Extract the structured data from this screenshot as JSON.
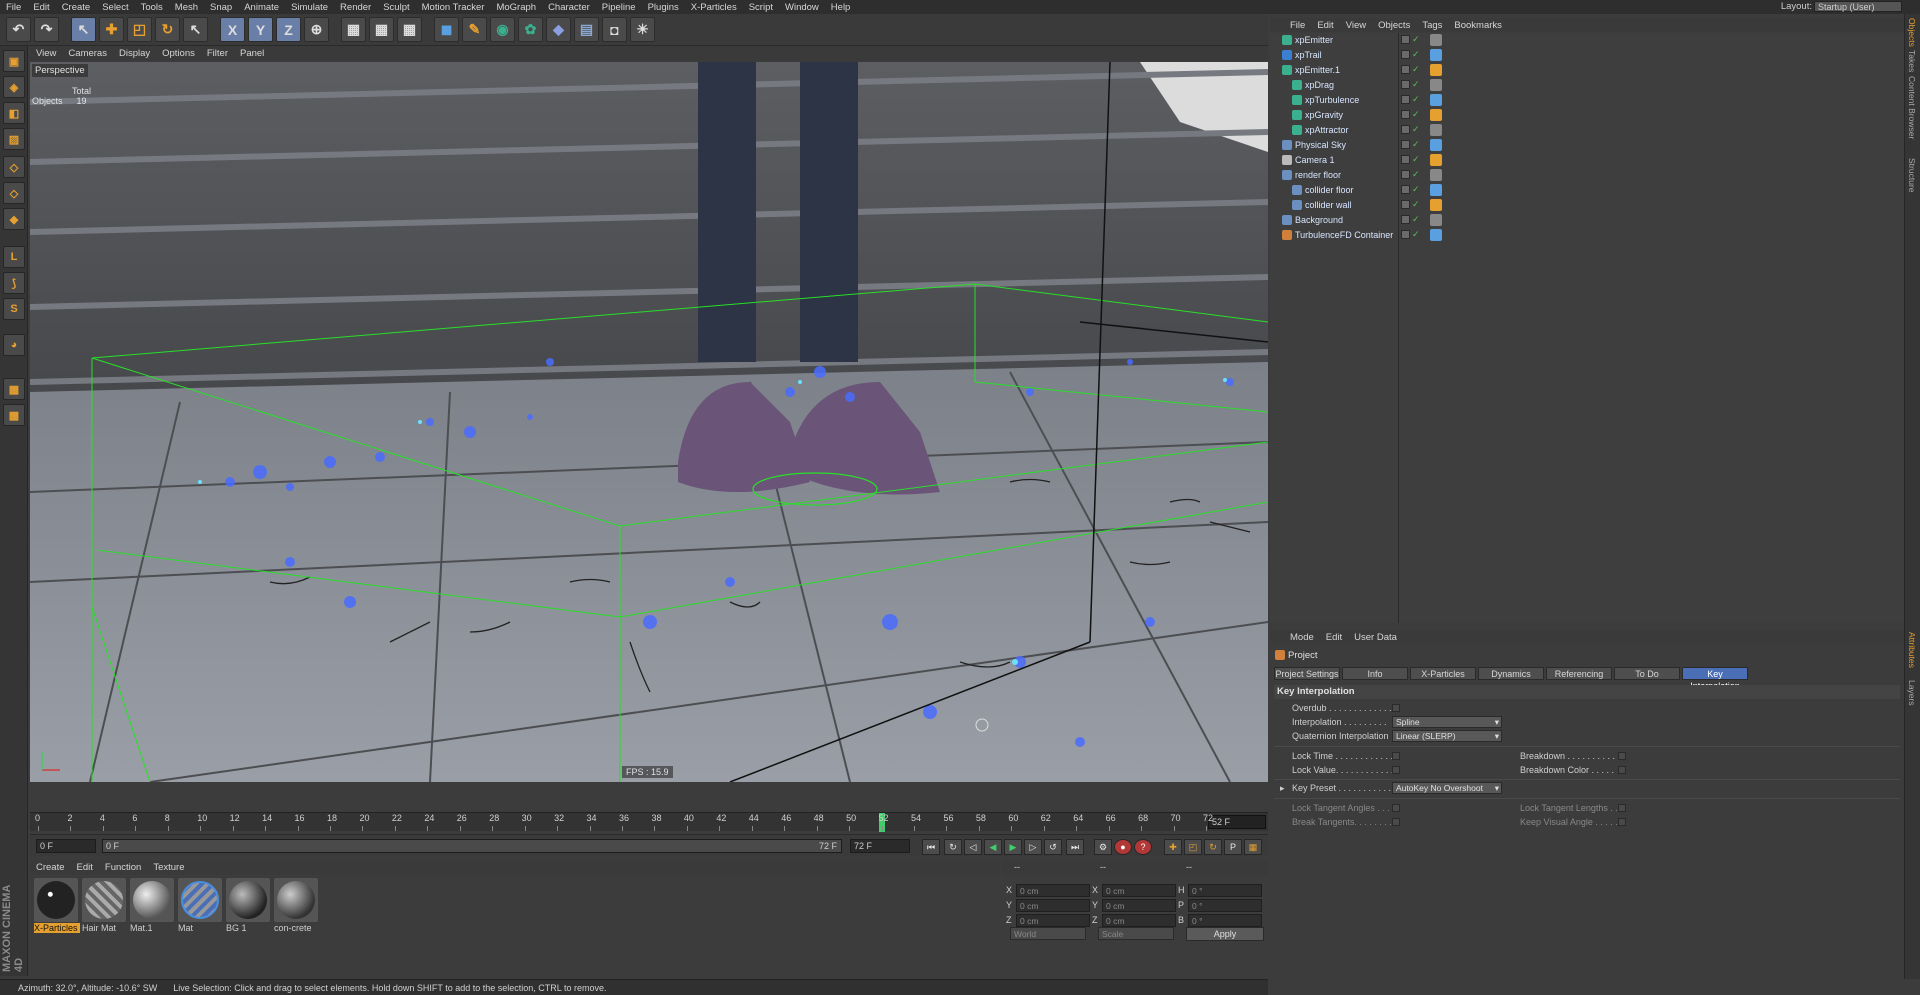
{
  "menubar": {
    "items": [
      "File",
      "Edit",
      "Create",
      "Select",
      "Tools",
      "Mesh",
      "Snap",
      "Animate",
      "Simulate",
      "Render",
      "Sculpt",
      "Motion Tracker",
      "MoGraph",
      "Character",
      "Pipeline",
      "Plugins",
      "X-Particles",
      "Script",
      "Window",
      "Help"
    ],
    "layout_label": "Layout:",
    "layout_value": "Startup (User)"
  },
  "toolbar": {
    "axis_x": "X",
    "axis_y": "Y",
    "axis_z": "Z"
  },
  "viewport": {
    "menu": [
      "View",
      "Cameras",
      "Display",
      "Options",
      "Filter",
      "Panel"
    ],
    "title": "Perspective",
    "hud_total_label": "Total",
    "hud_objects_label": "Objects",
    "hud_objects_value": "19",
    "fps": "FPS : 15.9"
  },
  "timeline": {
    "ticks": [
      "0",
      "2",
      "4",
      "6",
      "8",
      "10",
      "12",
      "14",
      "16",
      "18",
      "20",
      "22",
      "24",
      "26",
      "28",
      "30",
      "32",
      "34",
      "36",
      "38",
      "40",
      "42",
      "44",
      "46",
      "48",
      "50",
      "52",
      "54",
      "56",
      "58",
      "60",
      "62",
      "64",
      "66",
      "68",
      "70",
      "72"
    ],
    "current_frame": 52,
    "max_frame": 72,
    "end_field": "52 F"
  },
  "transport": {
    "start_field": "0 F",
    "range_start": "0 F",
    "range_end": "72 F",
    "end_field": "72 F"
  },
  "materials": {
    "menu": [
      "Create",
      "Edit",
      "Function",
      "Texture"
    ],
    "items": [
      {
        "name": "X-Particles",
        "highlighted": true
      },
      {
        "name": "Hair Mat",
        "highlighted": false
      },
      {
        "name": "Mat.1",
        "highlighted": false
      },
      {
        "name": "Mat",
        "highlighted": false
      },
      {
        "name": "BG 1",
        "highlighted": false
      },
      {
        "name": "con-crete",
        "highlighted": false
      }
    ]
  },
  "coordinates": {
    "header_left": "--",
    "header_mid": "--",
    "header_right": "--",
    "rows": [
      {
        "a": "X",
        "av": "0 cm",
        "b": "X",
        "bv": "0 cm",
        "c": "H",
        "cv": "0 °"
      },
      {
        "a": "Y",
        "av": "0 cm",
        "b": "Y",
        "bv": "0 cm",
        "c": "P",
        "cv": "0 °"
      },
      {
        "a": "Z",
        "av": "0 cm",
        "b": "Z",
        "bv": "0 cm",
        "c": "B",
        "cv": "0 °"
      }
    ],
    "mode1": "World",
    "mode2": "Scale",
    "apply": "Apply"
  },
  "statusbar": {
    "left": "Azimuth: 32.0°, Altitude: -10.6°  SW",
    "message": "Live Selection: Click and drag to select elements. Hold down SHIFT to add to the selection, CTRL to remove."
  },
  "objects": {
    "menu": [
      "File",
      "Edit",
      "View",
      "Objects",
      "Tags",
      "Bookmarks"
    ],
    "rows": [
      {
        "name": "xpEmitter",
        "indent": 0,
        "icon": "#3bb08f"
      },
      {
        "name": "xpTrail",
        "indent": 0,
        "icon": "#3b7fd0"
      },
      {
        "name": "xpEmitter.1",
        "indent": 0,
        "icon": "#3bb08f"
      },
      {
        "name": "xpDrag",
        "indent": 1,
        "icon": "#3bb08f"
      },
      {
        "name": "xpTurbulence",
        "indent": 1,
        "icon": "#3bb08f"
      },
      {
        "name": "xpGravity",
        "indent": 1,
        "icon": "#3bb08f"
      },
      {
        "name": "xpAttractor",
        "indent": 1,
        "icon": "#3bb08f"
      },
      {
        "name": "Physical Sky",
        "indent": 0,
        "icon": "#6a8fc0"
      },
      {
        "name": "Camera 1",
        "indent": 0,
        "icon": "#bbbbbb"
      },
      {
        "name": "render floor",
        "indent": 0,
        "icon": "#6a8fc0"
      },
      {
        "name": "collider floor",
        "indent": 1,
        "icon": "#6a8fc0"
      },
      {
        "name": "collider wall",
        "indent": 1,
        "icon": "#6a8fc0"
      },
      {
        "name": "Background",
        "indent": 0,
        "icon": "#6a8fc0"
      },
      {
        "name": "TurbulenceFD Container",
        "indent": 0,
        "icon": "#d0803b"
      }
    ]
  },
  "right_tabs": [
    "Objects",
    "Takes",
    "Content Browser",
    "Structure"
  ],
  "right_tabs_lower": [
    "Attributes",
    "Layers"
  ],
  "attributes": {
    "menu": [
      "Mode",
      "Edit",
      "User Data"
    ],
    "title": "Project",
    "tabs": [
      {
        "label": "Project Settings",
        "active": false
      },
      {
        "label": "Info",
        "active": false
      },
      {
        "label": "X-Particles",
        "active": false
      },
      {
        "label": "Dynamics",
        "active": false
      },
      {
        "label": "Referencing",
        "active": false
      },
      {
        "label": "To Do",
        "active": false
      },
      {
        "label": "Key Interpolation",
        "active": true
      }
    ],
    "section": "Key Interpolation",
    "overdub": "Overdub . . . . . . . . . . . . . .",
    "interpolation_label": "Interpolation . . . . . . . . .",
    "interpolation_value": "Spline",
    "quaternion_label": "Quaternion Interpolation",
    "quaternion_value": "Linear (SLERP)",
    "lock_time": "Lock Time . . . . . . . . . . . . .",
    "lock_value": "Lock Value. . . . . . . . . . . . .",
    "breakdown": "Breakdown . . . . . . . . . .",
    "breakdown_color": "Breakdown Color . . . . .",
    "key_preset_label": "Key Preset . . . . . . . . . . . .",
    "key_preset_value": "AutoKey No Overshoot",
    "lock_tangent_angles": "Lock Tangent Angles . . .",
    "break_tangents": "Break Tangents. . . . . . . . .",
    "lock_tangent_lengths": "Lock Tangent Lengths . .",
    "keep_visual_angle": "Keep Visual Angle . . . . ."
  },
  "colors": {
    "accent": "#e6a030",
    "active_tab": "#4a6fb6",
    "playhead": "#3fcf6a",
    "bbox_line": "#28e028"
  }
}
